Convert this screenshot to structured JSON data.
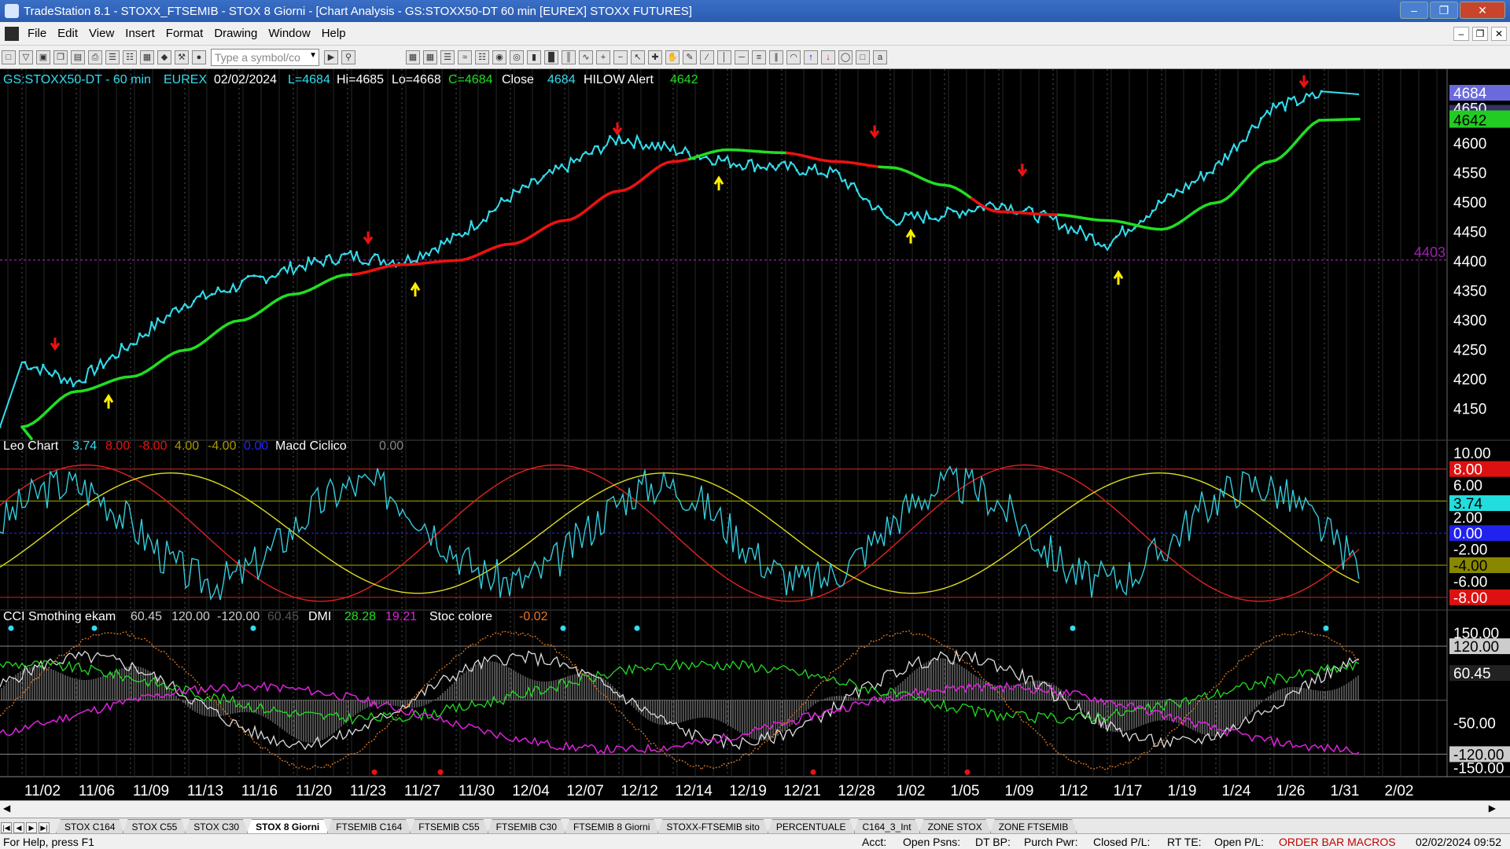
{
  "window": {
    "title": "TradeStation 8.1 - STOXX_FTSEMIB - STOX  8 Giorni - [Chart Analysis - GS:STOXX50-DT  60 min  [EUREX] STOXX FUTURES]"
  },
  "menu": {
    "items": [
      "File",
      "Edit",
      "View",
      "Insert",
      "Format",
      "Drawing",
      "Window",
      "Help"
    ]
  },
  "toolbar": {
    "symbol_placeholder": "Type a symbol/co"
  },
  "price_panel": {
    "symbol": "GS:STOXX50-DT - 60 min",
    "exchange": "EUREX",
    "date": "02/02/2024",
    "last": "L=4684",
    "high": "Hi=4685",
    "low": "Lo=4668",
    "close": "C=4684",
    "close_label": "Close",
    "close_value": "4684",
    "indicator": "HILOW Alert",
    "indicator_value": "4642",
    "ticks": [
      "4600",
      "4550",
      "4500",
      "4450",
      "4400",
      "4350",
      "4300",
      "4250",
      "4200",
      "4150"
    ],
    "last_box": "4684",
    "hilow_box": "4642",
    "hidden_box": "4650",
    "level_label": "4403",
    "ylim": [
      4100,
      4700
    ]
  },
  "macd_panel": {
    "title": "Leo Chart",
    "v1": "3.74",
    "v2": "8.00",
    "v3": "-8.00",
    "v4": "4.00",
    "v5": "-4.00",
    "v6": "0.00",
    "name": "Macd Ciclico",
    "value": "0.00",
    "ticks": [
      "10.00",
      "6.00",
      "2.00",
      "-2.00",
      "-6.00"
    ],
    "boxes": {
      "upper": "8.00",
      "current": "3.74",
      "zero": "0.00",
      "lower_mid": "-4.00",
      "lower": "-8.00"
    },
    "ylim": [
      -9,
      11
    ]
  },
  "cci_panel": {
    "title": "CCI Smothing ekam",
    "v1": "60.45",
    "v2": "120.00",
    "v3": "-120.00",
    "v4": "60.45",
    "dmi_label": "DMI",
    "dmi_plus": "28.28",
    "dmi_minus": "19.21",
    "stoc_label": "Stoc colore",
    "stoc_value": "-0.02",
    "ticks": [
      "150.00",
      "-50.00",
      "-150.00"
    ],
    "boxes": {
      "upper": "120.00",
      "current": "60.45",
      "lower": "-120.00"
    },
    "ylim": [
      -170,
      190
    ]
  },
  "xaxis": {
    "labels": [
      "11/02",
      "11/06",
      "11/09",
      "11/13",
      "11/16",
      "11/20",
      "11/23",
      "11/27",
      "11/30",
      "12/04",
      "12/07",
      "12/12",
      "12/14",
      "12/19",
      "12/21",
      "12/28",
      "1/02",
      "1/05",
      "1/09",
      "1/12",
      "1/17",
      "1/19",
      "1/24",
      "1/26",
      "1/31",
      "2/02"
    ]
  },
  "chart_data": {
    "type": "line",
    "x": [
      "11/02",
      "11/06",
      "11/09",
      "11/13",
      "11/16",
      "11/20",
      "11/23",
      "11/27",
      "11/30",
      "12/04",
      "12/07",
      "12/12",
      "12/14",
      "12/19",
      "12/21",
      "12/28",
      "1/02",
      "1/05",
      "1/09",
      "1/12",
      "1/17",
      "1/19",
      "1/24",
      "1/26",
      "1/31",
      "2/02"
    ],
    "series": [
      {
        "name": "Close",
        "values": [
          4230,
          4195,
          4260,
          4330,
          4360,
          4390,
          4410,
          4400,
          4440,
          4510,
          4560,
          4610,
          4590,
          4570,
          4560,
          4550,
          4470,
          4480,
          4500,
          4470,
          4430,
          4500,
          4560,
          4660,
          4684,
          null
        ]
      },
      {
        "name": "HILOW Alert",
        "values": [
          4120,
          4180,
          4205,
          4250,
          4300,
          4345,
          4378,
          4395,
          4402,
          4430,
          4470,
          4520,
          4570,
          4590,
          4585,
          4570,
          4560,
          4530,
          4485,
          4480,
          4470,
          4455,
          4500,
          4570,
          4642,
          null
        ]
      }
    ],
    "ylim": [
      4100,
      4700
    ]
  },
  "tabs": [
    "STOX C164",
    "STOX C55",
    "STOX  C30",
    "STOX  8 Giorni",
    "FTSEMIB C164",
    "FTSEMIB C55",
    "FTSEMIB C30",
    "FTSEMIB  8 Giorni",
    "STOXX-FTSEMIB sito",
    "PERCENTUALE",
    "C164_3_Int",
    "ZONE STOX",
    "ZONE FTSEMIB"
  ],
  "active_tab": "STOX  8 Giorni",
  "status": {
    "help": "For Help, press F1",
    "acct": "Acct:",
    "open_psns": "Open Psns:",
    "dt_bp": "DT BP:",
    "purch_pwr": "Purch Pwr:",
    "closed_pl": "Closed P/L:",
    "rt_te": "RT TE:",
    "open_pl": "Open P/L:",
    "macros": "ORDER BAR  MACROS",
    "datetime": "02/02/2024 09:52"
  },
  "colors": {
    "price": "#33ddee",
    "up_trend": "#22dd22",
    "down_trend": "#ee1111",
    "up_arrow": "#ffee00",
    "down_arrow": "#ee1111",
    "level": "#9922aa"
  }
}
